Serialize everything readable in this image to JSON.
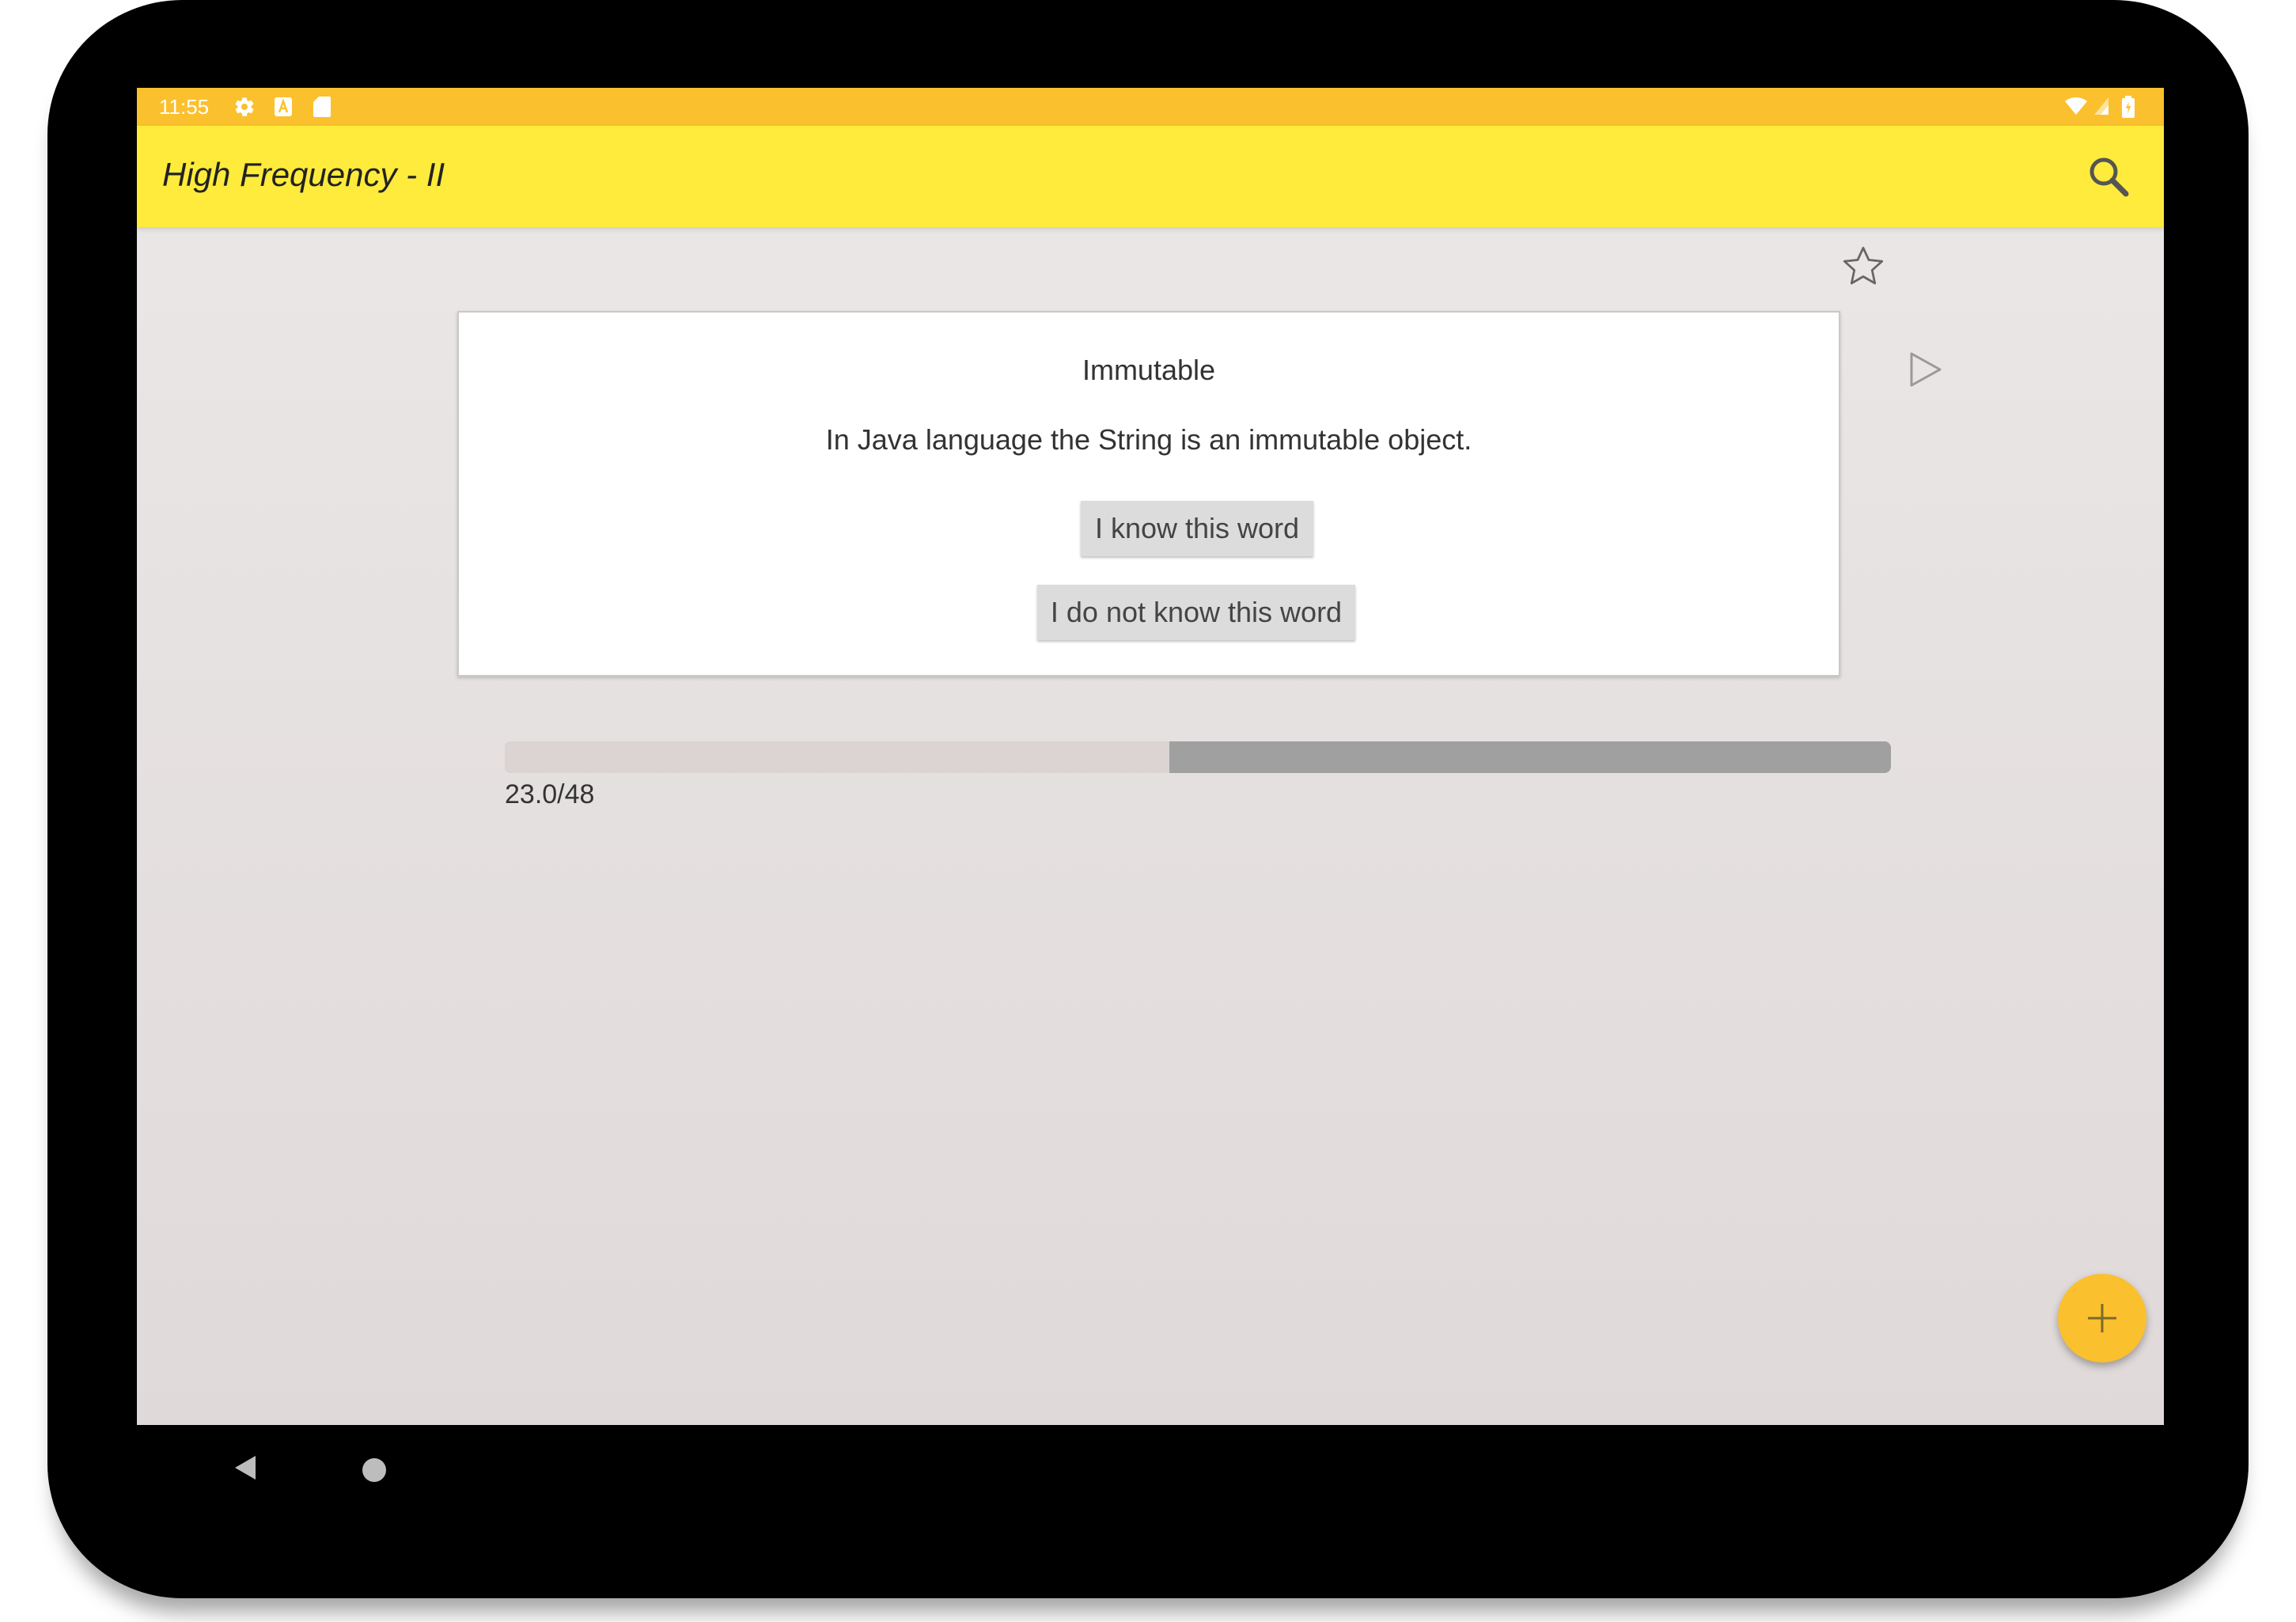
{
  "status_bar": {
    "time": "11:55",
    "left_icons": [
      "gear-icon",
      "a-letter-icon",
      "sd-card-icon"
    ],
    "right_icons": [
      "wifi-icon",
      "signal-icon",
      "battery-icon"
    ],
    "color": "#fbc02d"
  },
  "app_bar": {
    "title": "High Frequency - II",
    "action_icon": "search-icon",
    "color": "#ffeb3b"
  },
  "card": {
    "favorite_icon": "star-outline-icon",
    "word": "Immutable",
    "sentence": "In Java language the String is an immutable object.",
    "audio_icon": "play-icon",
    "know_button": "I know this word",
    "unknown_button": "I do not know this word"
  },
  "progress": {
    "text": "23.0/48",
    "current": 23.0,
    "total": 48
  },
  "fab": {
    "icon": "plus-icon",
    "color": "#fbc02d"
  },
  "navigation": {
    "back_icon": "back-triangle-icon",
    "home_icon": "home-circle-icon"
  }
}
